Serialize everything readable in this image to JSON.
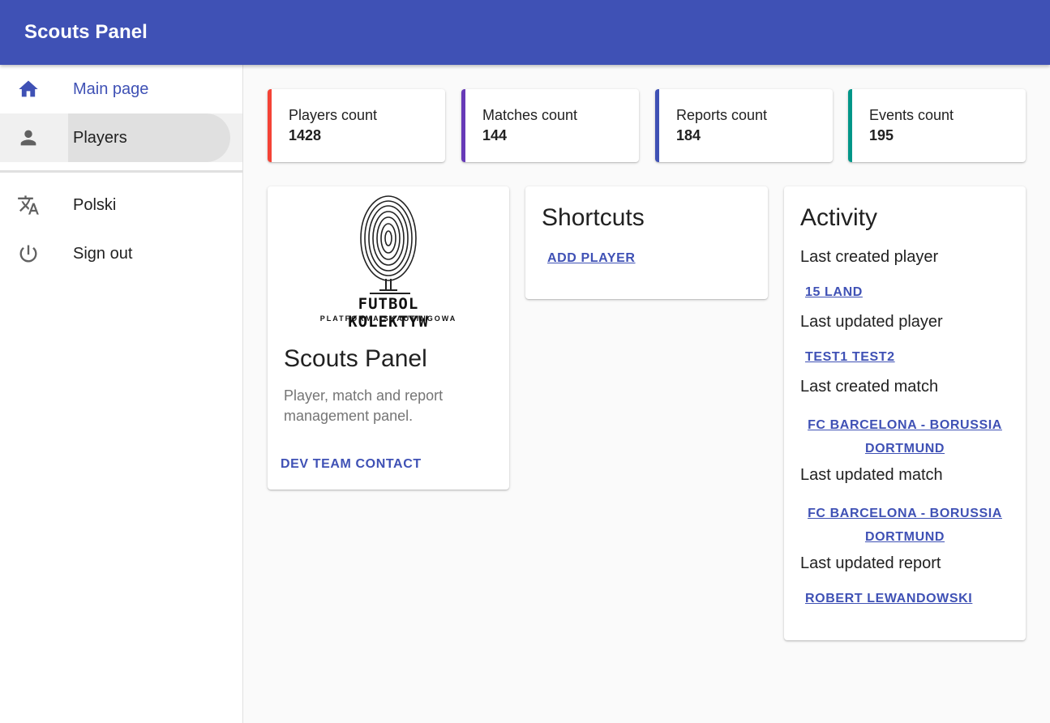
{
  "app": {
    "title": "Scouts Panel"
  },
  "sidebar": {
    "items": [
      {
        "label": "Main page",
        "icon": "home-icon"
      },
      {
        "label": "Players",
        "icon": "person-icon"
      }
    ],
    "secondary": [
      {
        "label": "Polski",
        "icon": "translate-icon"
      },
      {
        "label": "Sign out",
        "icon": "power-icon"
      }
    ]
  },
  "stats": [
    {
      "label": "Players count",
      "value": "1428",
      "color": "#f44336"
    },
    {
      "label": "Matches count",
      "value": "144",
      "color": "#673ab7"
    },
    {
      "label": "Reports count",
      "value": "184",
      "color": "#3f51b5"
    },
    {
      "label": "Events count",
      "value": "195",
      "color": "#009688"
    }
  ],
  "about": {
    "logo_text": "FUTBOL KOLEKTYW",
    "logo_subtext": "PLATFORMA SKAUTINGOWA",
    "title": "Scouts Panel",
    "description": "Player, match and report management panel.",
    "contact": "DEV TEAM CONTACT"
  },
  "shortcuts": {
    "title": "Shortcuts",
    "add_player": "ADD PLAYER"
  },
  "activity": {
    "title": "Activity",
    "last_created_player": {
      "label": "Last created player",
      "value": "15 LAND"
    },
    "last_updated_player": {
      "label": "Last updated player",
      "value": "TEST1 TEST2"
    },
    "last_created_match": {
      "label": "Last created match",
      "value": "FC BARCELONA - BORUSSIA DORTMUND"
    },
    "last_updated_match": {
      "label": "Last updated match",
      "value": "FC BARCELONA - BORUSSIA DORTMUND"
    },
    "last_updated_report": {
      "label": "Last updated report",
      "value": "ROBERT LEWANDOWSKI"
    }
  },
  "colors": {
    "primary": "#3f51b5",
    "background": "#fafafa"
  }
}
